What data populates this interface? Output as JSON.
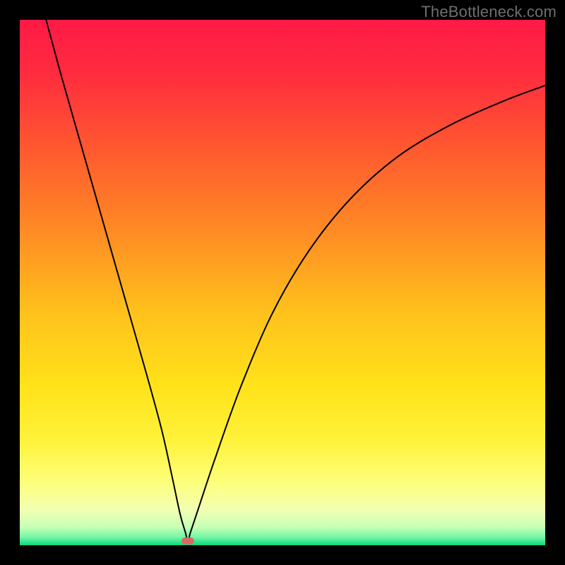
{
  "watermark": {
    "text": "TheBottleneck.com"
  },
  "chart_data": {
    "type": "line",
    "title": "",
    "xlabel": "",
    "ylabel": "",
    "xlim": [
      0,
      100
    ],
    "ylim": [
      0,
      100
    ],
    "grid": false,
    "legend": false,
    "background_gradient": {
      "stops": [
        {
          "offset": 0.0,
          "color": "#ff1a46"
        },
        {
          "offset": 0.1,
          "color": "#ff2b3f"
        },
        {
          "offset": 0.25,
          "color": "#ff5a2f"
        },
        {
          "offset": 0.4,
          "color": "#ff8a24"
        },
        {
          "offset": 0.55,
          "color": "#ffbf1c"
        },
        {
          "offset": 0.7,
          "color": "#ffe31a"
        },
        {
          "offset": 0.8,
          "color": "#fff23a"
        },
        {
          "offset": 0.88,
          "color": "#fdff7a"
        },
        {
          "offset": 0.93,
          "color": "#f3ffb0"
        },
        {
          "offset": 0.965,
          "color": "#c8ffb8"
        },
        {
          "offset": 0.985,
          "color": "#73f7a3"
        },
        {
          "offset": 1.0,
          "color": "#07d981"
        }
      ]
    },
    "series": [
      {
        "name": "bottleneck-curve",
        "color": "#000000",
        "x": [
          5,
          8,
          12,
          16,
          20,
          24,
          27,
          29,
          30.5,
          31.5,
          32,
          32.5,
          34,
          37,
          42,
          48,
          55,
          63,
          72,
          82,
          92,
          100
        ],
        "values": [
          100,
          89,
          75,
          61,
          47,
          33,
          22,
          13,
          6,
          2.5,
          0.8,
          2.5,
          7,
          16,
          30,
          44,
          56,
          66,
          74,
          80,
          84.5,
          87.5
        ]
      }
    ],
    "marker": {
      "name": "optimal-point",
      "x": 32,
      "y": 0.8,
      "color": "#d96a62"
    }
  }
}
